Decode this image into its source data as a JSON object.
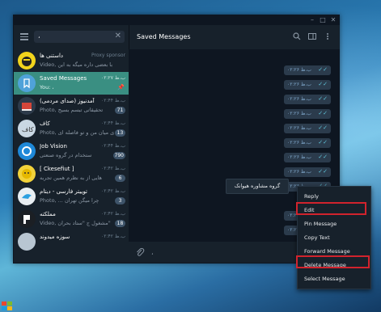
{
  "window": {
    "minimize": "–",
    "maximize": "□",
    "close": "✕"
  },
  "search": {
    "value": "،",
    "clear": "✕"
  },
  "chats": [
    {
      "name": "داستنی ها",
      "time": "Proxy sponsor",
      "preview": "Video, سیبورد با بعضی داره میگه به این",
      "badge": ""
    },
    {
      "name": "Saved Messages",
      "time": "ب.ظ ۰۲:۲۷",
      "preview": "You: ،",
      "badge": ""
    },
    {
      "name": "(صدای مردمی) آمدنیوز",
      "time": "ب.ظ ۰۲:۴۴",
      "preview": "Photo, تحقیقاتی تبسم بسیج",
      "badge": "71"
    },
    {
      "name": "کاف",
      "time": "ب.ظ ۰۲:۴۴",
      "preview": "Photo, فاصله ای میان من و تو فاصله ای",
      "badge": "13"
    },
    {
      "name": "Job Vision",
      "time": "ب.ظ ۰۲:۴۴",
      "preview": "ستخدام در گروه صنعتی",
      "badge": "790"
    },
    {
      "name": "[ Ckesefiut ]",
      "time": "ب.ظ ۰۲:۴۲",
      "preview": "هایی از به نظرم همین تجربه",
      "badge": "6"
    },
    {
      "name": "توییتر فارسی - دیتام",
      "time": "ب.ظ ۰۲:۴۲",
      "preview": "Photo, ... چرا میگن تهران",
      "badge": "3"
    },
    {
      "name": "مملکته",
      "time": "ب.ظ ۰۲:۴۲",
      "preview": "Video, مشغول ج \"ستاد بحران\"",
      "badge": "18"
    },
    {
      "name": "سوزه میدوند",
      "time": "ب.ظ ۰۲:۴۲",
      "preview": "",
      "badge": ""
    }
  ],
  "header": {
    "title": "Saved Messages"
  },
  "messages": [
    {
      "time": "ب.ظ ۰۲:۲۶",
      "check": "✓✓"
    },
    {
      "time": "ب.ظ ۰۲:۲۶",
      "check": "✓✓"
    },
    {
      "time": "ب.ظ ۰۲:۲۶",
      "check": "✓✓"
    },
    {
      "time": "ب.ظ ۰۲:۲۶",
      "check": "✓✓"
    },
    {
      "time": "ب.ظ ۰۲:۲۶",
      "check": "✓✓"
    },
    {
      "time": "ب.ظ ۰۲:۲۶",
      "check": "✓✓"
    },
    {
      "time": "ب.ظ ۰۲:۲۶",
      "check": "✓✓"
    },
    {
      "time": "ب.ظ ۰۲:۲۶",
      "check": "✓✓"
    },
    {
      "time": "ب.ظ ۰۲:۲۶",
      "check": "✓✓"
    },
    {
      "time": "ب.ظ ۰۲:۲۶",
      "check": "✓✓"
    },
    {
      "time": "ب.ظ ۰۲:۲۶",
      "check": "✓✓"
    }
  ],
  "tooltip": "گروه مشاوره هیوانک",
  "composer": {
    "placeholder": "،"
  },
  "context_menu": [
    "Reply",
    "Edit",
    "Pin Message",
    "Copy Text",
    "Forward Message",
    "Delete Message",
    "Select Message"
  ],
  "highlight_color": "#d1232d",
  "accent_color": "#3a8f82"
}
